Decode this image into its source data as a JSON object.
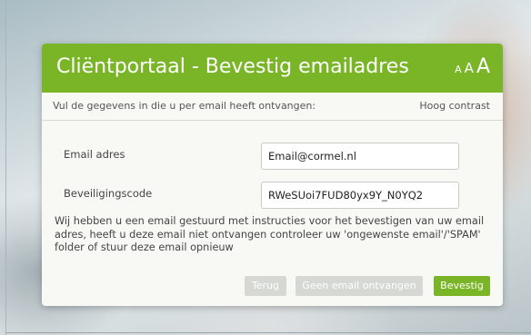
{
  "header": {
    "title": "Cliëntportaal - Bevestig emailadres",
    "font_small": "A",
    "font_medium": "A",
    "font_large": "A"
  },
  "subheader": {
    "intro": "Vul de gegevens in die u per email heeft ontvangen:",
    "contrast_link": "Hoog contrast"
  },
  "form": {
    "email_label": "Email adres",
    "email_value": "Email@cormel.nl",
    "code_label": "Beveiligingscode",
    "code_value": "RWeSUoi7FUD80yx9Y_N0YQ2"
  },
  "message": "Wij hebben u een email gestuurd met instructies voor het bevestigen van uw email adres, heeft u deze email niet ontvangen controleer uw 'ongewenste email'/'SPAM' folder of stuur deze email opnieuw",
  "buttons": {
    "back": "Terug",
    "resend": "Geen email ontvangen",
    "confirm": "Bevestig"
  },
  "colors": {
    "brand_green": "#7ab527",
    "disabled_button": "#d6d8d3"
  }
}
